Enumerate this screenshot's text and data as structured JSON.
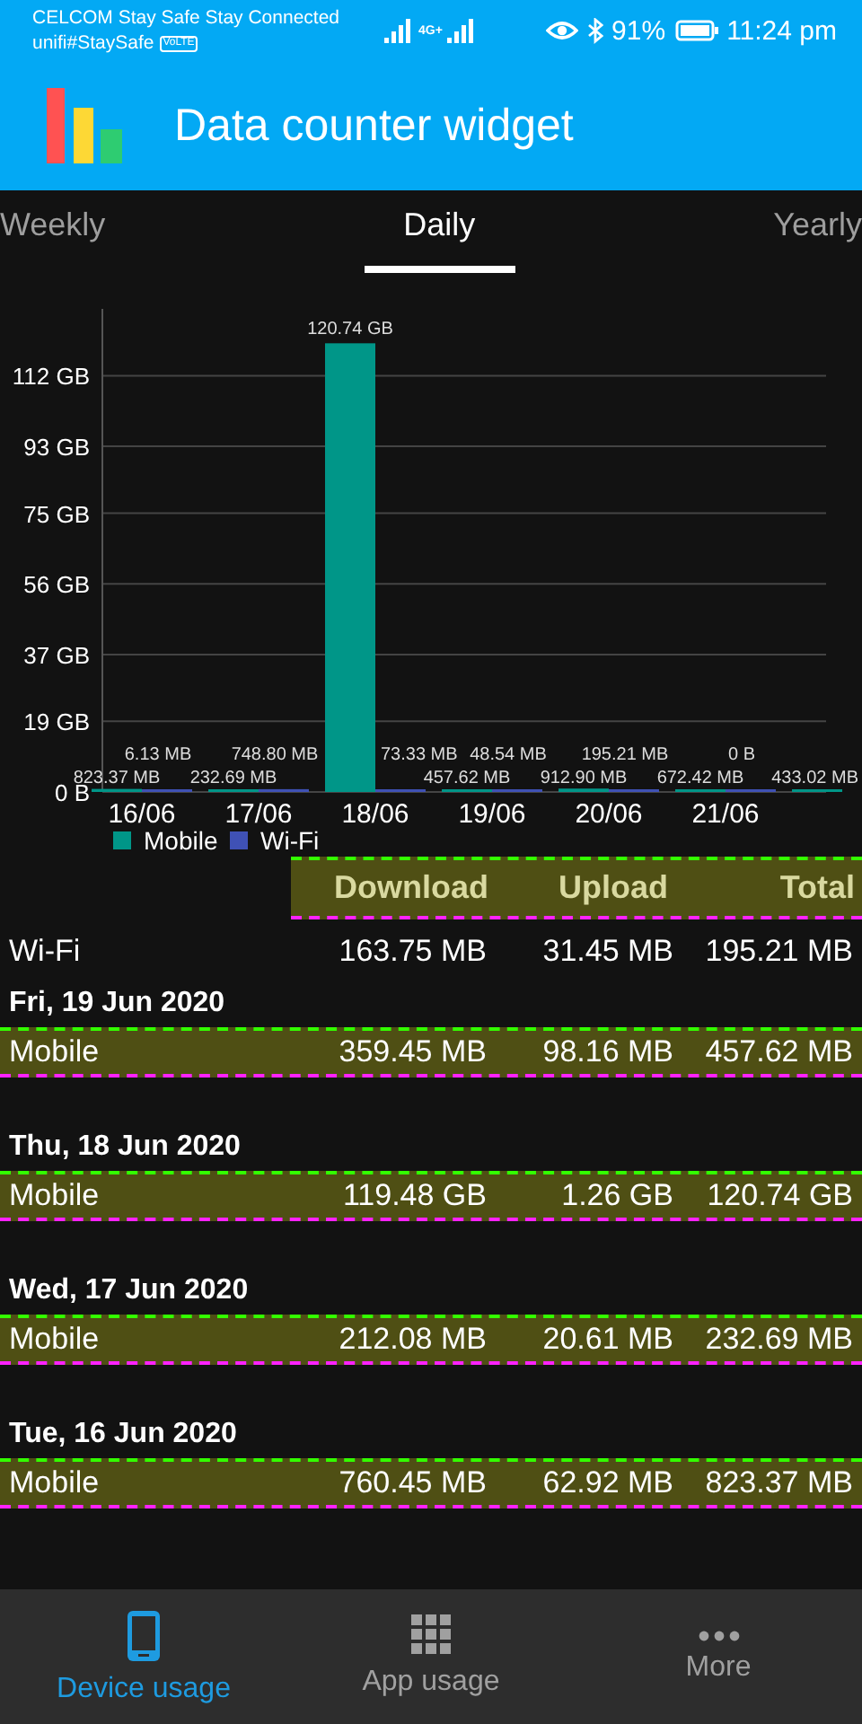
{
  "status_bar": {
    "carrier": "CELCOM Stay Safe Stay Connected",
    "carrier_2": "unifi#StaySafe",
    "volte_badge": "VoLTE",
    "network": "4G+",
    "battery": "91%",
    "time": "11:24 pm"
  },
  "app_bar": {
    "title": "Data counter widget"
  },
  "tabs": [
    {
      "label": "Weekly",
      "selected": false
    },
    {
      "label": "Daily",
      "selected": true
    },
    {
      "label": "Yearly",
      "selected": false
    }
  ],
  "chart": {
    "chart_data": {
      "type": "bar",
      "categories": [
        "16/06",
        "17/06",
        "18/06",
        "19/06",
        "20/06",
        "21/06",
        null
      ],
      "series": [
        {
          "name": "Mobile",
          "color": "#009688",
          "values": [
            0.82,
            0.23,
            120.74,
            0.46,
            0.91,
            0.67,
            0.43
          ]
        },
        {
          "name": "Wi-Fi",
          "color": "#3f51b5",
          "values": [
            0.01,
            0.75,
            0.07,
            0.05,
            0.2,
            0,
            null
          ]
        }
      ],
      "value_labels": [
        [
          "823.37 MB",
          "232.69 MB",
          "120.74 GB",
          "457.62 MB",
          "912.90 MB",
          "672.42 MB",
          "433.02 MB"
        ],
        [
          "6.13 MB",
          "748.80 MB",
          "73.33 MB",
          "48.54 MB",
          "195.21 MB",
          "0 B",
          null
        ]
      ],
      "grid": true,
      "legend": "bottom-left",
      "ylim": [
        0,
        130
      ],
      "yticks": [
        {
          "value": 0,
          "label": "0 B"
        },
        {
          "value": 19,
          "label": "19 GB"
        },
        {
          "value": 37,
          "label": "37 GB"
        },
        {
          "value": 56,
          "label": "56 GB"
        },
        {
          "value": 75,
          "label": "75 GB"
        },
        {
          "value": 93,
          "label": "93 GB"
        },
        {
          "value": 112,
          "label": "112 GB"
        }
      ],
      "orientation": "vertical"
    }
  },
  "table": {
    "columns": [
      "Download",
      "Upload",
      "Total"
    ],
    "summary": {
      "label": "Wi-Fi",
      "download": "163.75 MB",
      "upload": "31.45 MB",
      "total": "195.21 MB"
    },
    "days": [
      {
        "date": "Fri, 19 Jun 2020",
        "rows": [
          {
            "label": "Mobile",
            "download": "359.45 MB",
            "upload": "98.16 MB",
            "total": "457.62 MB"
          }
        ]
      },
      {
        "date": "Thu, 18 Jun 2020",
        "rows": [
          {
            "label": "Mobile",
            "download": "119.48 GB",
            "upload": "1.26 GB",
            "total": "120.74 GB"
          }
        ]
      },
      {
        "date": "Wed, 17 Jun 2020",
        "rows": [
          {
            "label": "Mobile",
            "download": "212.08 MB",
            "upload": "20.61 MB",
            "total": "232.69 MB"
          }
        ]
      },
      {
        "date": "Tue, 16 Jun 2020",
        "rows": [
          {
            "label": "Mobile",
            "download": "760.45 MB",
            "upload": "62.92 MB",
            "total": "823.37 MB"
          }
        ]
      }
    ]
  },
  "bottom_nav": [
    {
      "label": "Device usage",
      "kind": "phone",
      "selected": true
    },
    {
      "label": "App usage",
      "kind": "grid",
      "selected": false
    },
    {
      "label": "More",
      "kind": "dots",
      "selected": false
    }
  ]
}
